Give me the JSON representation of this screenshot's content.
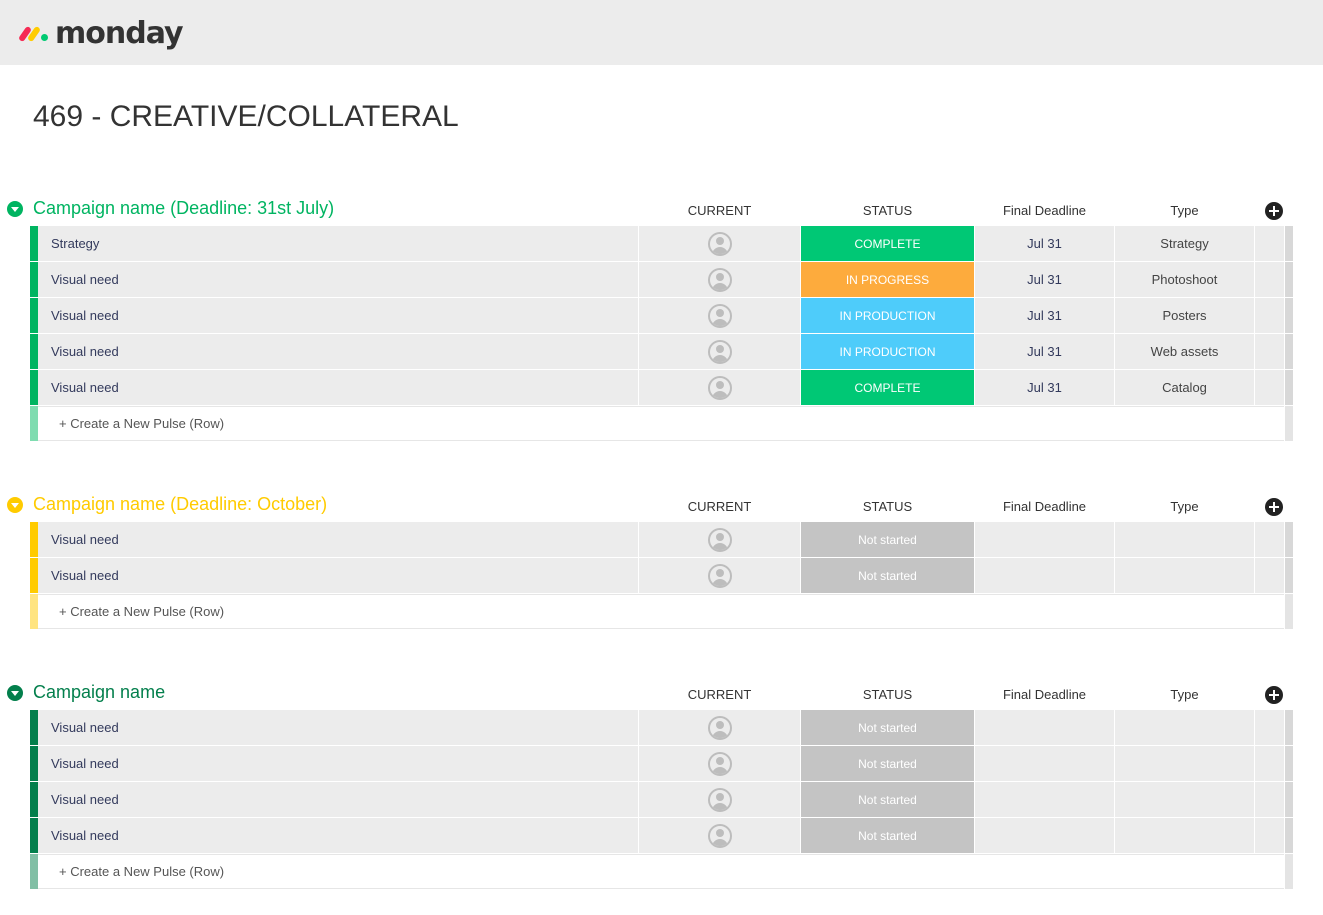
{
  "app": {
    "logo_text": "monday"
  },
  "board": {
    "title": "469 - CREATIVE/COLLATERAL"
  },
  "columns": {
    "current": "CURRENT",
    "status": "STATUS",
    "deadline": "Final Deadline",
    "type": "Type"
  },
  "create_label": "+ Create a New Pulse (Row)",
  "colors": {
    "complete": "#00c875",
    "in_progress": "#fdab3d",
    "in_production": "#4eccfa",
    "not_started": "#c4c4c4",
    "group1": "#00b461",
    "group2": "#ffcb00",
    "group3": "#037f4c"
  },
  "groups": [
    {
      "name": "Campaign name (Deadline: 31st July)",
      "rows": [
        {
          "name": "Strategy",
          "status": "COMPLETE",
          "deadline": "Jul 31",
          "type": "Strategy"
        },
        {
          "name": "Visual need",
          "status": "IN PROGRESS",
          "deadline": "Jul 31",
          "type": "Photoshoot"
        },
        {
          "name": "Visual need",
          "status": "IN PRODUCTION",
          "deadline": "Jul 31",
          "type": "Posters"
        },
        {
          "name": "Visual need",
          "status": "IN PRODUCTION",
          "deadline": "Jul 31",
          "type": "Web assets"
        },
        {
          "name": "Visual need",
          "status": "COMPLETE",
          "deadline": "Jul 31",
          "type": "Catalog"
        }
      ]
    },
    {
      "name": "Campaign name (Deadline: October)",
      "rows": [
        {
          "name": "Visual need",
          "status": "Not started",
          "deadline": "",
          "type": ""
        },
        {
          "name": "Visual need",
          "status": "Not started",
          "deadline": "",
          "type": ""
        }
      ]
    },
    {
      "name": "Campaign name",
      "rows": [
        {
          "name": "Visual need",
          "status": "Not started",
          "deadline": "",
          "type": ""
        },
        {
          "name": "Visual need",
          "status": "Not started",
          "deadline": "",
          "type": ""
        },
        {
          "name": "Visual need",
          "status": "Not started",
          "deadline": "",
          "type": ""
        },
        {
          "name": "Visual need",
          "status": "Not started",
          "deadline": "",
          "type": ""
        }
      ]
    }
  ]
}
